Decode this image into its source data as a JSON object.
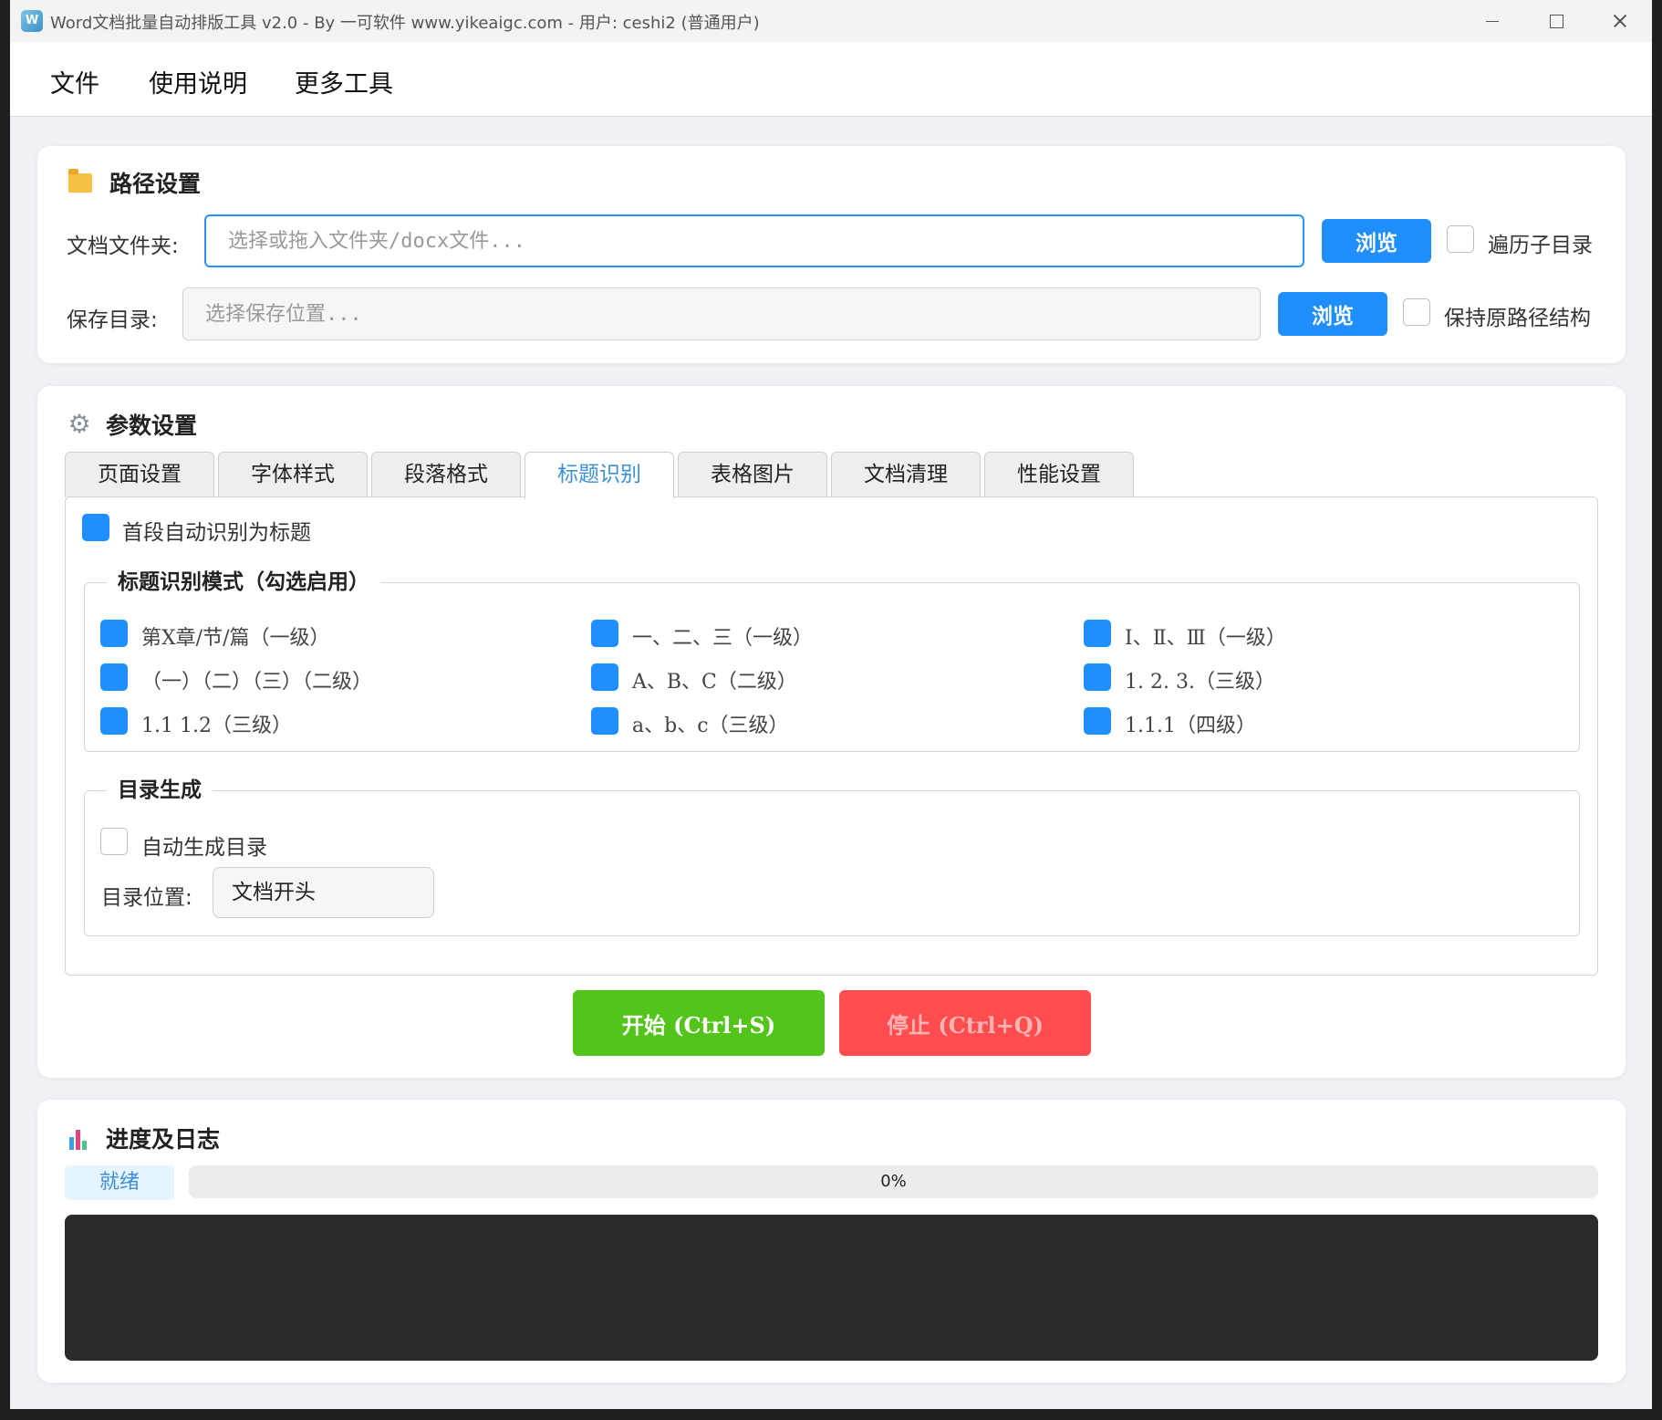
{
  "window": {
    "title": "Word文档批量自动排版工具 v2.0 - By 一可软件 www.yikeaigc.com - 用户: ceshi2 (普通用户)",
    "icon_letter": "W"
  },
  "menu": {
    "items": [
      {
        "label": "文件"
      },
      {
        "label": "使用说明"
      },
      {
        "label": "更多工具"
      }
    ]
  },
  "path_settings": {
    "title": "路径设置",
    "doc_folder_label": "文档文件夹:",
    "doc_folder_placeholder": "选择或拖入文件夹/docx文件...",
    "doc_folder_value": "",
    "save_dir_label": "保存目录:",
    "save_dir_placeholder": "选择保存位置...",
    "save_dir_value": "",
    "browse_label": "浏览",
    "recurse_label": "遍历子目录",
    "recurse_checked": false,
    "keep_structure_label": "保持原路径结构",
    "keep_structure_checked": false
  },
  "param_settings": {
    "title": "参数设置",
    "tabs": [
      {
        "label": "页面设置",
        "active": false
      },
      {
        "label": "字体样式",
        "active": false
      },
      {
        "label": "段落格式",
        "active": false
      },
      {
        "label": "标题识别",
        "active": true
      },
      {
        "label": "表格图片",
        "active": false
      },
      {
        "label": "文档清理",
        "active": false
      },
      {
        "label": "性能设置",
        "active": false
      }
    ],
    "first_para_heading_label": "首段自动识别为标题",
    "first_para_heading_checked": true,
    "heading_modes": {
      "title": "标题识别模式（勾选启用）",
      "items": [
        {
          "label": "第X章/节/篇（一级）",
          "checked": true
        },
        {
          "label": "一、二、三（一级）",
          "checked": true
        },
        {
          "label": "Ⅰ、Ⅱ、Ⅲ（一级）",
          "checked": true
        },
        {
          "label": "（一）（二）（三）（二级）",
          "checked": true
        },
        {
          "label": "A、B、C（二级）",
          "checked": true
        },
        {
          "label": "1. 2. 3.（三级）",
          "checked": true
        },
        {
          "label": "1.1 1.2（三级）",
          "checked": true
        },
        {
          "label": "a、b、c（三级）",
          "checked": true
        },
        {
          "label": "1.1.1（四级）",
          "checked": true
        }
      ]
    },
    "toc": {
      "title": "目录生成",
      "auto_toc_label": "自动生成目录",
      "auto_toc_checked": false,
      "position_label": "目录位置:",
      "position_value": "文档开头"
    },
    "start_label": "开始 (Ctrl+S)",
    "stop_label": "停止 (Ctrl+Q)"
  },
  "progress": {
    "title": "进度及日志",
    "status": "就绪",
    "percent_text": "0%",
    "fraction": 0,
    "log_text": ""
  },
  "colors": {
    "primary": "#1f8fff",
    "start": "#52c41a",
    "stop": "#ff4d4f",
    "tab_active_text": "#3d8fd6",
    "log_bg": "#2b2b2b"
  },
  "icons": {
    "path_section": "folder-icon",
    "param_section": "gear-icon",
    "progress_section": "bar-chart-icon"
  }
}
